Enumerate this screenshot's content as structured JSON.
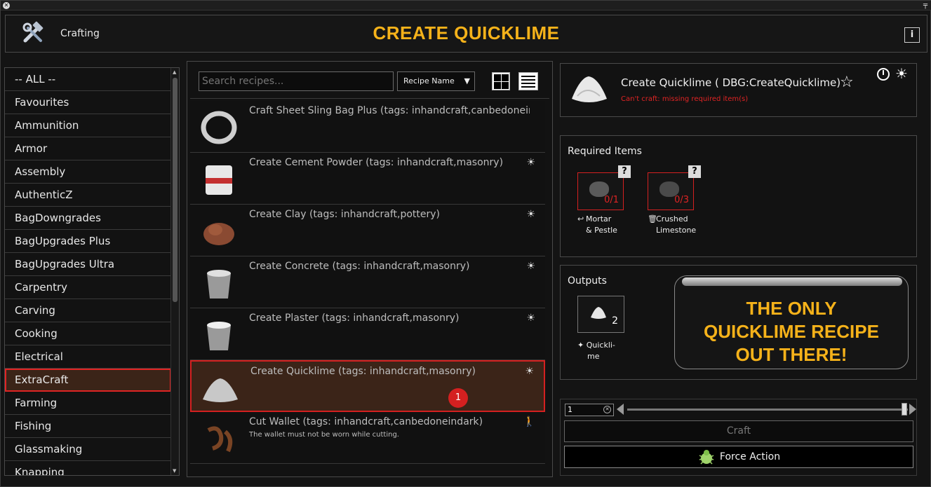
{
  "window": {
    "close_icon": "close-icon",
    "pin_glyph": "╤"
  },
  "header": {
    "app_name": "Crafting",
    "title": "CREATE QUICKLIME",
    "info_glyph": "i",
    "title_color": "#f5b21a"
  },
  "categories": [
    {
      "label": "-- ALL --"
    },
    {
      "label": "Favourites"
    },
    {
      "label": "Ammunition"
    },
    {
      "label": "Armor"
    },
    {
      "label": "Assembly"
    },
    {
      "label": "AuthenticZ"
    },
    {
      "label": "BagDowngrades"
    },
    {
      "label": "BagUpgrades Plus"
    },
    {
      "label": "BagUpgrades Ultra"
    },
    {
      "label": "Carpentry"
    },
    {
      "label": "Carving"
    },
    {
      "label": "Cooking"
    },
    {
      "label": "Electrical"
    },
    {
      "label": "ExtraCraft",
      "selected": true
    },
    {
      "label": "Farming"
    },
    {
      "label": "Fishing"
    },
    {
      "label": "Glassmaking"
    },
    {
      "label": "Knapping"
    }
  ],
  "search": {
    "placeholder": "Search recipes..."
  },
  "sort": {
    "label": "Recipe Name"
  },
  "recipes": [
    {
      "name": "Craft Sheet Sling Bag Plus (tags: inhandcraft,canbedoneindark)",
      "status_icon": "none"
    },
    {
      "name": "Create Cement Powder (tags: inhandcraft,masonry)",
      "status_icon": "sun-icon"
    },
    {
      "name": "Create Clay (tags: inhandcraft,pottery)",
      "status_icon": "sun-icon"
    },
    {
      "name": "Create Concrete (tags: inhandcraft,masonry)",
      "status_icon": "sun-icon"
    },
    {
      "name": "Create Plaster (tags: inhandcraft,masonry)",
      "status_icon": "sun-icon"
    },
    {
      "name": "Create Quicklime (tags: inhandcraft,masonry)",
      "status_icon": "sun-icon",
      "selected": true,
      "badge": "1"
    },
    {
      "name": "Cut Wallet (tags: inhandcraft,canbedoneindark)",
      "sub": "The wallet must not be worn while cutting.",
      "status_icon": "walking-icon"
    }
  ],
  "detail": {
    "title": "Create Quicklime ( DBG:CreateQuicklime)",
    "error": "Can't craft: missing required item(s)",
    "error_color": "#e02424"
  },
  "required": {
    "label": "Required Items",
    "items": [
      {
        "count": "0/1",
        "name_line1": "Mortar",
        "name_line2": "& Pestle",
        "mini_icon": "return-icon",
        "help": "?"
      },
      {
        "count": "0/3",
        "name_line1": "Crushed",
        "name_line2": "Limestone",
        "mini_icon": "trash-icon",
        "help": "?"
      }
    ]
  },
  "outputs": {
    "label": "Outputs",
    "count": "2",
    "name_line1": "Quickli-",
    "name_line2": "me",
    "mini_icon": "sparkle-icon"
  },
  "caption": {
    "line1": "THE ONLY",
    "line2": "QUICKLIME RECIPE",
    "line3": "OUT THERE!"
  },
  "actions": {
    "quantity": "1",
    "craft_label": "Craft",
    "force_label": "Force Action"
  }
}
